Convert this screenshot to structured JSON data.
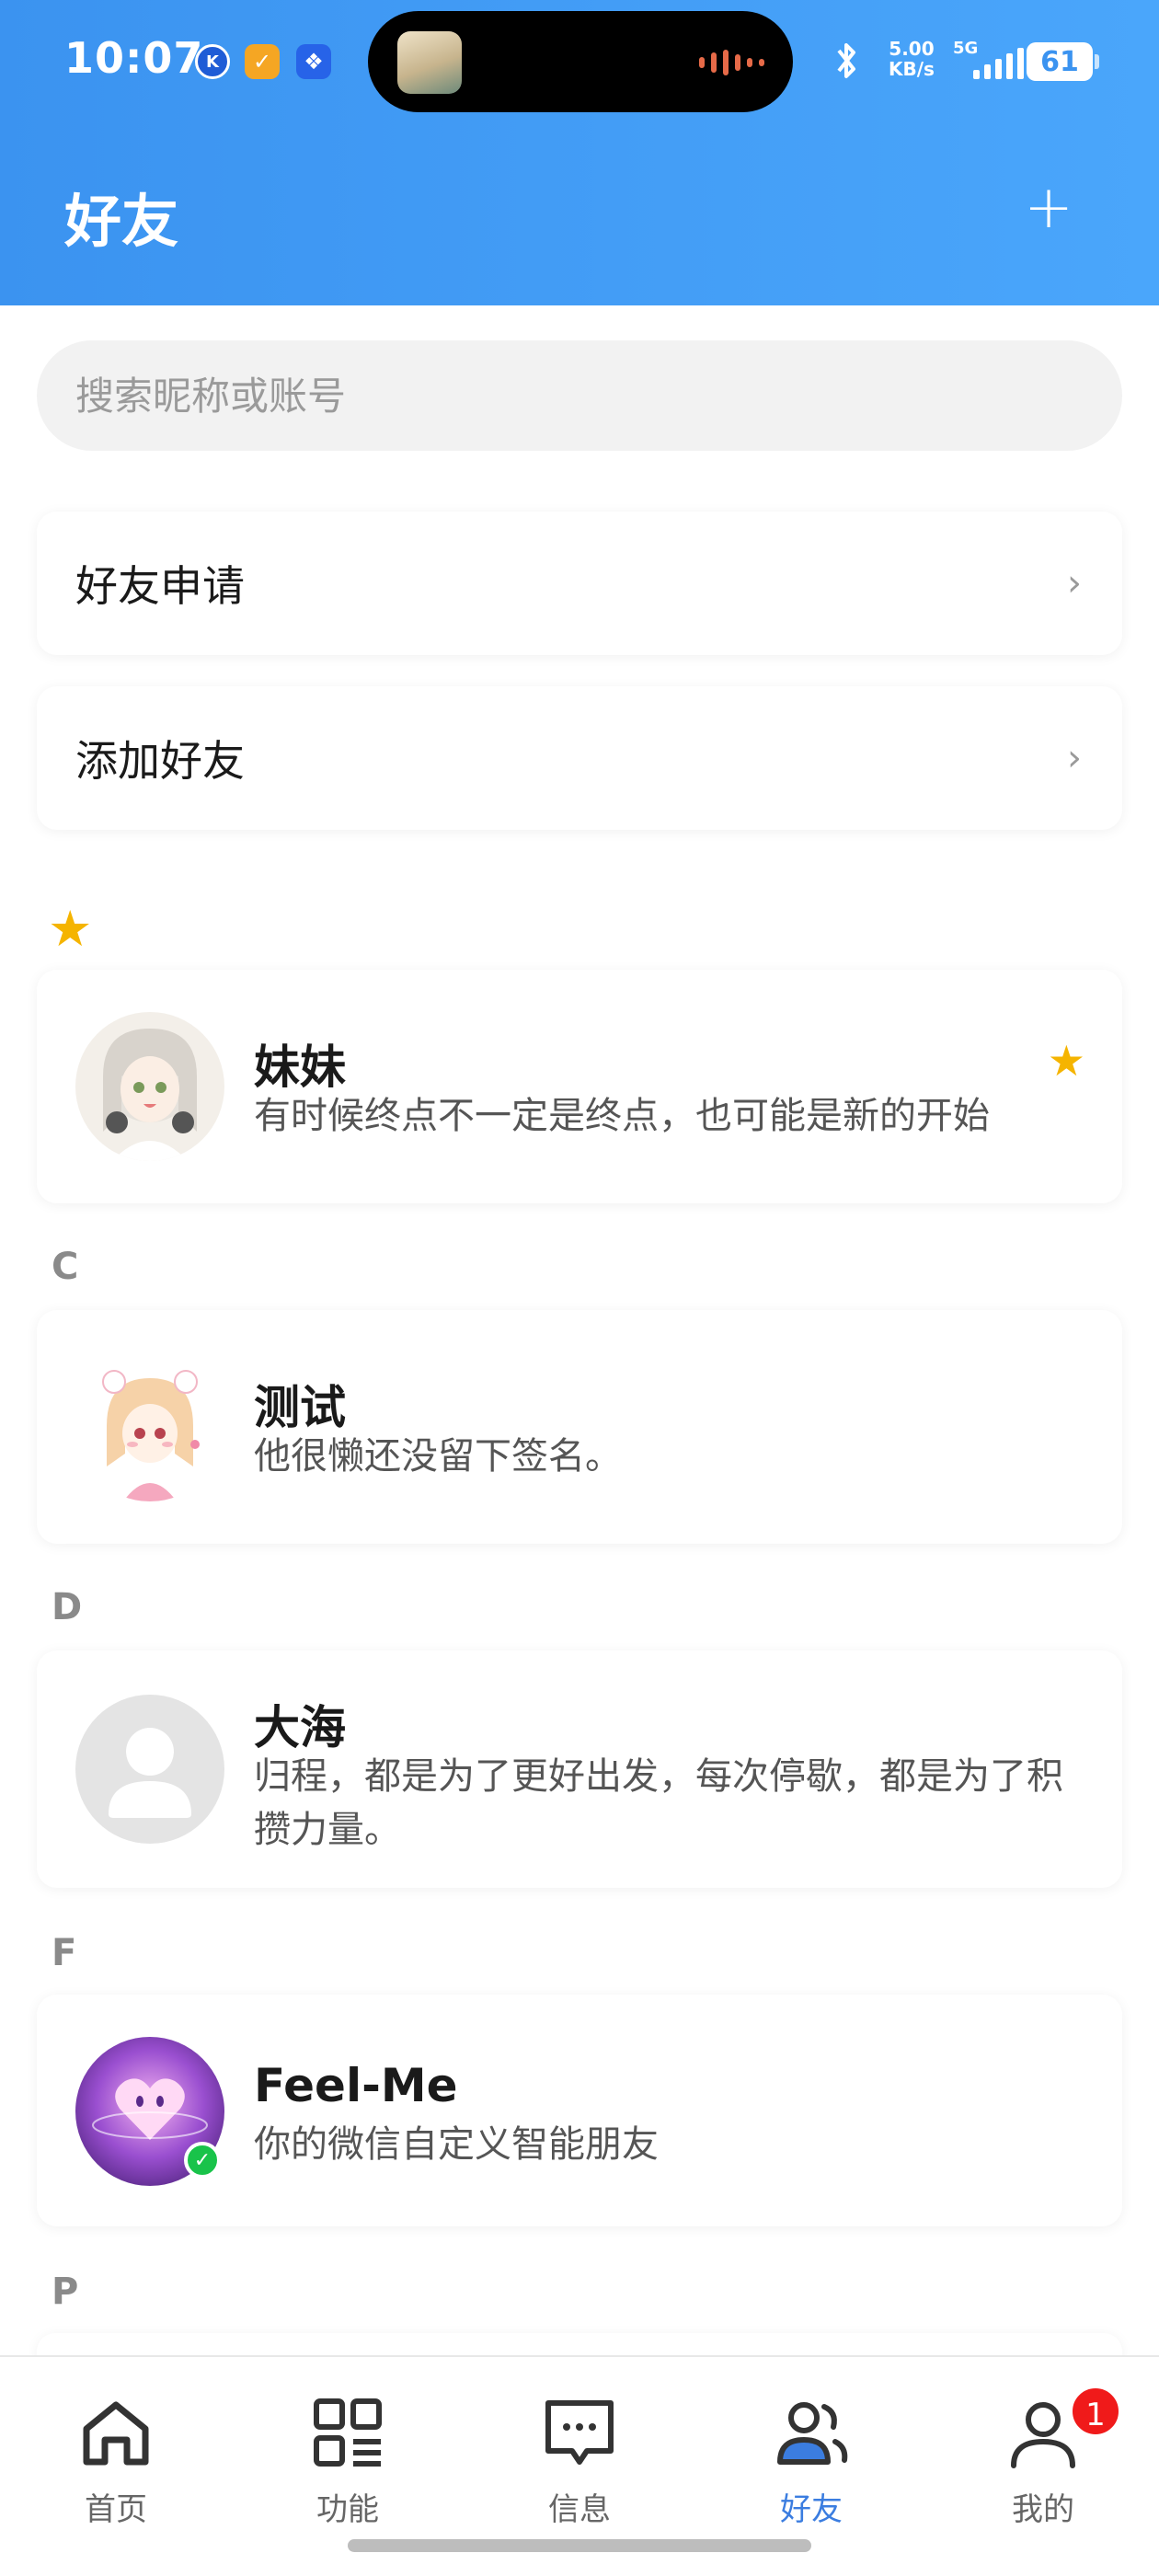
{
  "status_bar": {
    "time": "10:07",
    "apps": [
      "K",
      "✓",
      "❖"
    ],
    "speed_value": "5.00",
    "speed_unit": "KB/s",
    "network": "5G",
    "battery": "61"
  },
  "header": {
    "title": "好友",
    "add_label": "+"
  },
  "search": {
    "placeholder": "搜索昵称或账号"
  },
  "entries": [
    {
      "label": "好友申请",
      "chevron": "›"
    },
    {
      "label": "添加好友",
      "chevron": "›"
    }
  ],
  "sections": {
    "starred_symbol": "★",
    "c": "C",
    "d": "D",
    "f": "F",
    "p": "P"
  },
  "friends": [
    {
      "name": "妹妹",
      "signature": "有时候终点不一定是终点，也可能是新的开始",
      "starred": true,
      "star": "★"
    },
    {
      "name": "测试",
      "signature": "他很懒还没留下签名。"
    },
    {
      "name": "大海",
      "signature": "归程，都是为了更好出发，每次停歇，都是为了积攒力量。"
    },
    {
      "name": "Feel-Me",
      "signature": "你的微信自定义智能朋友",
      "verified_mark": "✓"
    }
  ],
  "nav": {
    "items": [
      {
        "label": "首页",
        "icon": "home-icon"
      },
      {
        "label": "功能",
        "icon": "grid-icon"
      },
      {
        "label": "信息",
        "icon": "message-icon"
      },
      {
        "label": "好友",
        "icon": "friends-icon",
        "active": true
      },
      {
        "label": "我的",
        "icon": "profile-icon"
      }
    ],
    "badge": "1"
  },
  "colors": {
    "header": "#3b93f0",
    "active": "#3b7de0",
    "star": "#f5b400",
    "badge": "#f01a1a"
  }
}
